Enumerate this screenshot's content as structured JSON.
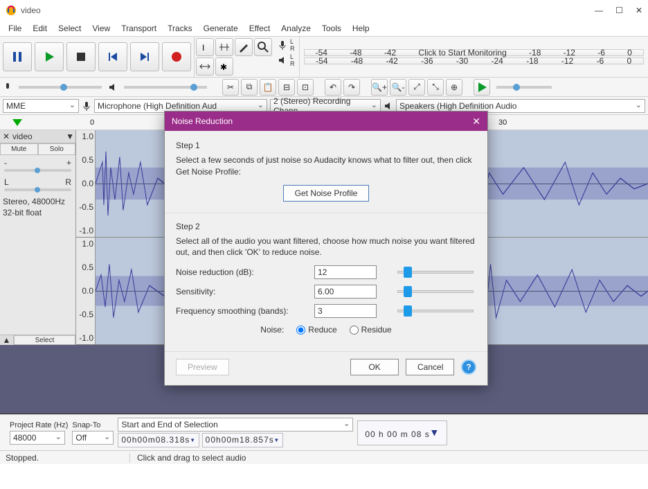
{
  "window": {
    "title": "video"
  },
  "menu": [
    "File",
    "Edit",
    "Select",
    "View",
    "Transport",
    "Tracks",
    "Generate",
    "Effect",
    "Analyze",
    "Tools",
    "Help"
  ],
  "meters": {
    "rec_ticks": [
      "-54",
      "-48",
      "-42",
      "Click to Start Monitoring",
      "-18",
      "-12",
      "-6",
      "0"
    ],
    "play_ticks": [
      "-54",
      "-48",
      "-42",
      "-36",
      "-30",
      "-24",
      "-18",
      "-12",
      "-6",
      "0"
    ]
  },
  "devices": {
    "host": "MME",
    "input": "Microphone (High Definition Aud",
    "channels": "2 (Stereo) Recording Chann",
    "output": "Speakers (High Definition Audio"
  },
  "timeline": {
    "ticks": [
      {
        "pos": 130,
        "label": "0"
      },
      {
        "pos": 720,
        "label": "30"
      }
    ]
  },
  "track": {
    "name": "video",
    "mute": "Mute",
    "solo": "Solo",
    "gain_left": "-",
    "gain_right": "+",
    "pan_left": "L",
    "pan_right": "R",
    "info1": "Stereo, 48000Hz",
    "info2": "32-bit float",
    "select": "Select",
    "scale": [
      "1.0",
      "0.5",
      "0.0",
      "-0.5",
      "-1.0"
    ]
  },
  "dialog": {
    "title": "Noise Reduction",
    "step1_h": "Step 1",
    "step1_p": "Select a few seconds of just noise so Audacity knows what to filter out, then click Get Noise Profile:",
    "get_profile": "Get Noise Profile",
    "step2_h": "Step 2",
    "step2_p": "Select all of the audio you want filtered, choose how much noise you want filtered out, and then click 'OK' to reduce noise.",
    "nr_label": "Noise reduction (dB):",
    "nr_value": "12",
    "sens_label": "Sensitivity:",
    "sens_value": "6.00",
    "freq_label": "Frequency smoothing (bands):",
    "freq_value": "3",
    "noise_label": "Noise:",
    "reduce": "Reduce",
    "residue": "Residue",
    "preview": "Preview",
    "ok": "OK",
    "cancel": "Cancel"
  },
  "footer": {
    "rate_label": "Project Rate (Hz)",
    "rate_value": "48000",
    "snap_label": "Snap-To",
    "snap_value": "Off",
    "sel_label": "Start and End of Selection",
    "sel_start": "00h00m08.318s",
    "sel_end": "00h00m18.857s",
    "big_time": "00 h 00 m 08 s"
  },
  "status": {
    "left": "Stopped.",
    "right": "Click and drag to select audio"
  }
}
